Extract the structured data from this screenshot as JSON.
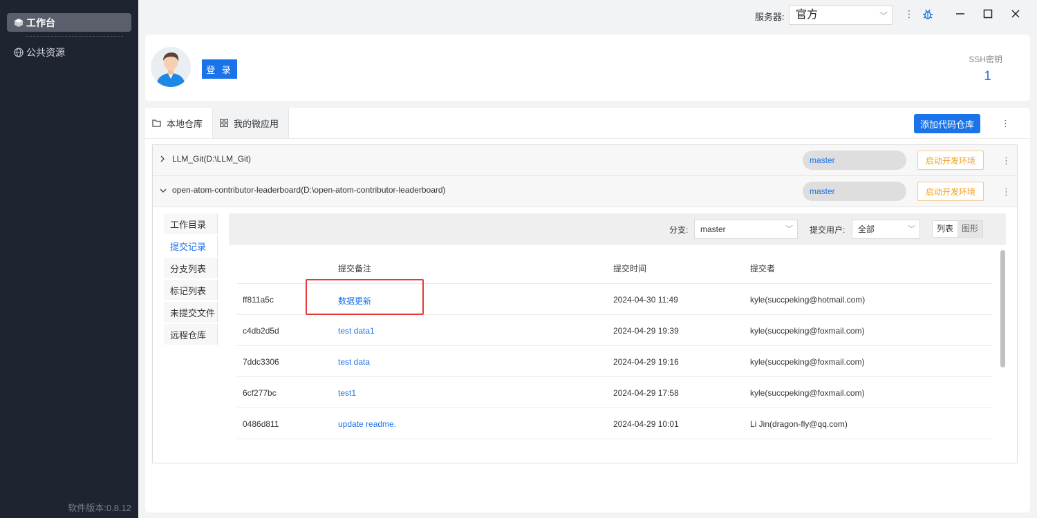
{
  "sidebar": {
    "items": [
      {
        "label": "工作台",
        "active": true
      },
      {
        "label": "公共资源",
        "active": false
      }
    ],
    "version": "软件版本:0.8.12"
  },
  "topbar": {
    "server_label": "服务器:",
    "server_value": "官方"
  },
  "profile": {
    "login_label": "登 录",
    "ssh_label": "SSH密钥",
    "ssh_count": "1"
  },
  "tabs": [
    {
      "label": "本地仓库",
      "icon": "folder-icon",
      "active": true
    },
    {
      "label": "我的微应用",
      "icon": "grid-icon",
      "active": false
    }
  ],
  "add_repo_label": "添加代码仓库",
  "repos": [
    {
      "name": "LLM_Git(D:\\LLM_Git)",
      "branch": "master",
      "env_label": "启动开发环境",
      "expanded": false
    },
    {
      "name": "open-atom-contributor-leaderboard(D:\\open-atom-contributor-leaderboard)",
      "branch": "master",
      "env_label": "启动开发环境",
      "expanded": true
    }
  ],
  "inner_nav": [
    "工作目录",
    "提交记录",
    "分支列表",
    "标记列表",
    "未提交文件",
    "远程仓库"
  ],
  "filter": {
    "branch_label": "分支:",
    "branch_value": "master",
    "user_label": "提交用户:",
    "user_value": "全部",
    "view_list": "列表",
    "view_graph": "图形"
  },
  "table": {
    "headers": [
      "提交备注",
      "提交时间",
      "提交者"
    ],
    "rows": [
      {
        "hash": "ff811a5c",
        "message": "数据更新",
        "time": "2024-04-30 11:49",
        "author": "kyle(succpeking@hotmail.com)"
      },
      {
        "hash": "c4db2d5d",
        "message": "test data1",
        "time": "2024-04-29 19:39",
        "author": "kyle(succpeking@foxmail.com)"
      },
      {
        "hash": "7ddc3306",
        "message": "test data",
        "time": "2024-04-29 19:16",
        "author": "kyle(succpeking@foxmail.com)"
      },
      {
        "hash": "6cf277bc",
        "message": "test1",
        "time": "2024-04-29 17:58",
        "author": "kyle(succpeking@foxmail.com)"
      },
      {
        "hash": "0486d811",
        "message": "update readme.",
        "time": "2024-04-29 10:01",
        "author": "Li Jin(dragon-fly@qq.com)"
      }
    ]
  },
  "colors": {
    "accent": "#1a73e8",
    "sidebar": "#1f2431",
    "warning": "#f0a020",
    "highlight": "#e53935"
  }
}
